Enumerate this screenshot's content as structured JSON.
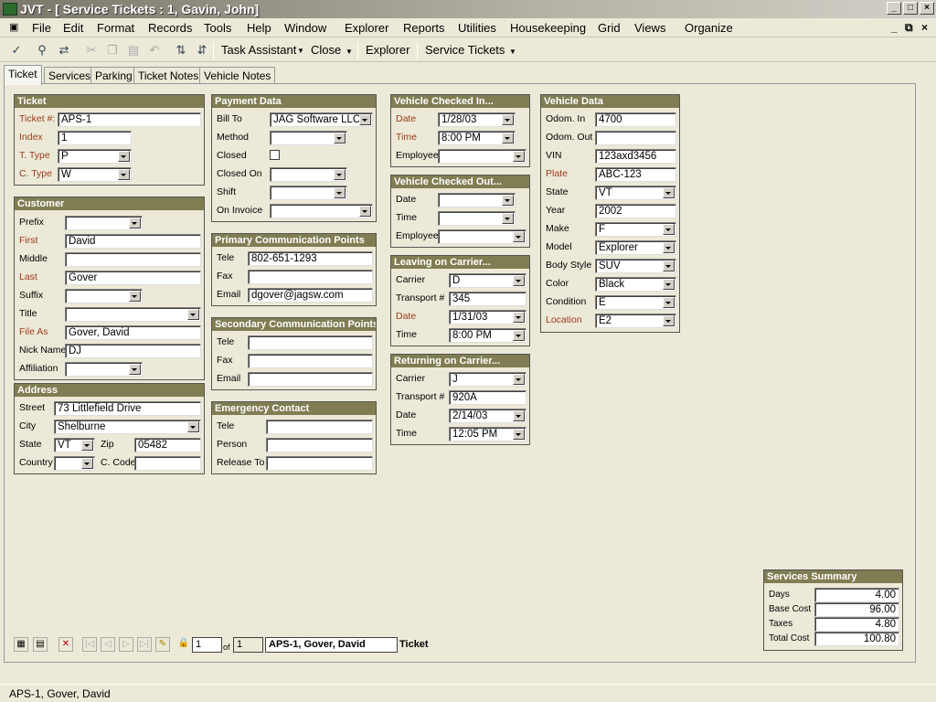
{
  "window": {
    "title": "JVT - [ Service Tickets : 1, Gavin, John]"
  },
  "menu": [
    "File",
    "Edit",
    "Format",
    "Records",
    "Tools",
    "Help",
    "Window",
    "Explorer",
    "Reports",
    "Utilities",
    "Housekeeping",
    "Grid",
    "Views",
    "Organize"
  ],
  "toolbar": {
    "task_assistant": "Task Assistant",
    "close": "Close",
    "explorer": "Explorer",
    "service_tickets": "Service Tickets"
  },
  "tabs": [
    "Ticket",
    "Services",
    "Parking",
    "Ticket Notes",
    "Vehicle Notes"
  ],
  "ticket": {
    "title": "Ticket",
    "ticket_no_label": "Ticket #:",
    "ticket_no": "APS-1",
    "index_label": "Index",
    "index": "1",
    "ttype_label": "T. Type",
    "ttype": "P",
    "ctype_label": "C. Type",
    "ctype": "W"
  },
  "customer": {
    "title": "Customer",
    "prefix_label": "Prefix",
    "prefix": "",
    "first_label": "First",
    "first": "David",
    "middle_label": "Middle",
    "middle": "",
    "last_label": "Last",
    "last": "Gover",
    "suffix_label": "Suffix",
    "suffix": "",
    "title_label": "Title",
    "title_val": "",
    "fileas_label": "File As",
    "fileas": "Gover, David",
    "nick_label": "Nick Name",
    "nick": "DJ",
    "affil_label": "Affiliation",
    "affil": ""
  },
  "address": {
    "title": "Address",
    "street_label": "Street",
    "street": "73 Littlefield Drive",
    "city_label": "City",
    "city": "Shelburne",
    "state_label": "State",
    "state": "VT",
    "zip_label": "Zip",
    "zip": "05482",
    "country_label": "Country",
    "country": "",
    "ccode_label": "C. Code",
    "ccode": ""
  },
  "payment": {
    "title": "Payment Data",
    "billto_label": "Bill To",
    "billto": "JAG Software LLC",
    "method_label": "Method",
    "method": "",
    "closed_label": "Closed",
    "closedon_label": "Closed On",
    "closedon": "",
    "shift_label": "Shift",
    "shift": "",
    "oninvoice_label": "On Invoice",
    "oninvoice": ""
  },
  "primary_comm": {
    "title": "Primary Communication Points",
    "tele_label": "Tele",
    "tele": "802-651-1293",
    "fax_label": "Fax",
    "fax": "",
    "email_label": "Email",
    "email": "dgover@jagsw.com"
  },
  "secondary_comm": {
    "title": "Secondary Communication Points",
    "tele_label": "Tele",
    "tele": "",
    "fax_label": "Fax",
    "fax": "",
    "email_label": "Email",
    "email": ""
  },
  "emergency": {
    "title": "Emergency Contact",
    "tele_label": "Tele",
    "tele": "",
    "person_label": "Person",
    "person": "",
    "release_label": "Release To",
    "release": ""
  },
  "checked_in": {
    "title": "Vehicle Checked In...",
    "date_label": "Date",
    "date": "1/28/03",
    "time_label": "Time",
    "time": "8:00 PM",
    "employee_label": "Employee",
    "employee": ""
  },
  "checked_out": {
    "title": "Vehicle Checked Out...",
    "date_label": "Date",
    "date": "",
    "time_label": "Time",
    "time": "",
    "employee_label": "Employee",
    "employee": ""
  },
  "leaving": {
    "title": "Leaving on Carrier...",
    "carrier_label": "Carrier",
    "carrier": "D",
    "transport_label": "Transport #",
    "transport": "345",
    "date_label": "Date",
    "date": "1/31/03",
    "time_label": "Time",
    "time": "8:00 PM"
  },
  "returning": {
    "title": "Returning on Carrier...",
    "carrier_label": "Carrier",
    "carrier": "J",
    "transport_label": "Transport #",
    "transport": "920A",
    "date_label": "Date",
    "date": "2/14/03",
    "time_label": "Time",
    "time": "12:05 PM"
  },
  "vehicle": {
    "title": "Vehicle Data",
    "odomin_label": "Odom. In",
    "odomin": "4700",
    "odomout_label": "Odom. Out",
    "odomout": "",
    "vin_label": "VIN",
    "vin": "123axd3456",
    "plate_label": "Plate",
    "plate": "ABC-123",
    "state_label": "State",
    "state": "VT",
    "year_label": "Year",
    "year": "2002",
    "make_label": "Make",
    "make": "F",
    "model_label": "Model",
    "model": "Explorer",
    "body_label": "Body Style",
    "body": "SUV",
    "color_label": "Color",
    "color": "Black",
    "condition_label": "Condition",
    "condition": "E",
    "location_label": "Location",
    "location": "E2"
  },
  "summary": {
    "title": "Services Summary",
    "days_label": "Days",
    "days": "4.00",
    "base_label": "Base Cost",
    "base": "96.00",
    "taxes_label": "Taxes",
    "taxes": "4.80",
    "total_label": "Total Cost",
    "total": "100.80"
  },
  "nav": {
    "record": "1",
    "of_label": "of",
    "total": "1",
    "current": "APS-1, Gover, David",
    "type": "Ticket"
  },
  "status": "APS-1, Gover, David",
  "colors": {
    "group_header": "#807d52",
    "required_label": "#9c3a1a",
    "background": "#ece9d8"
  }
}
